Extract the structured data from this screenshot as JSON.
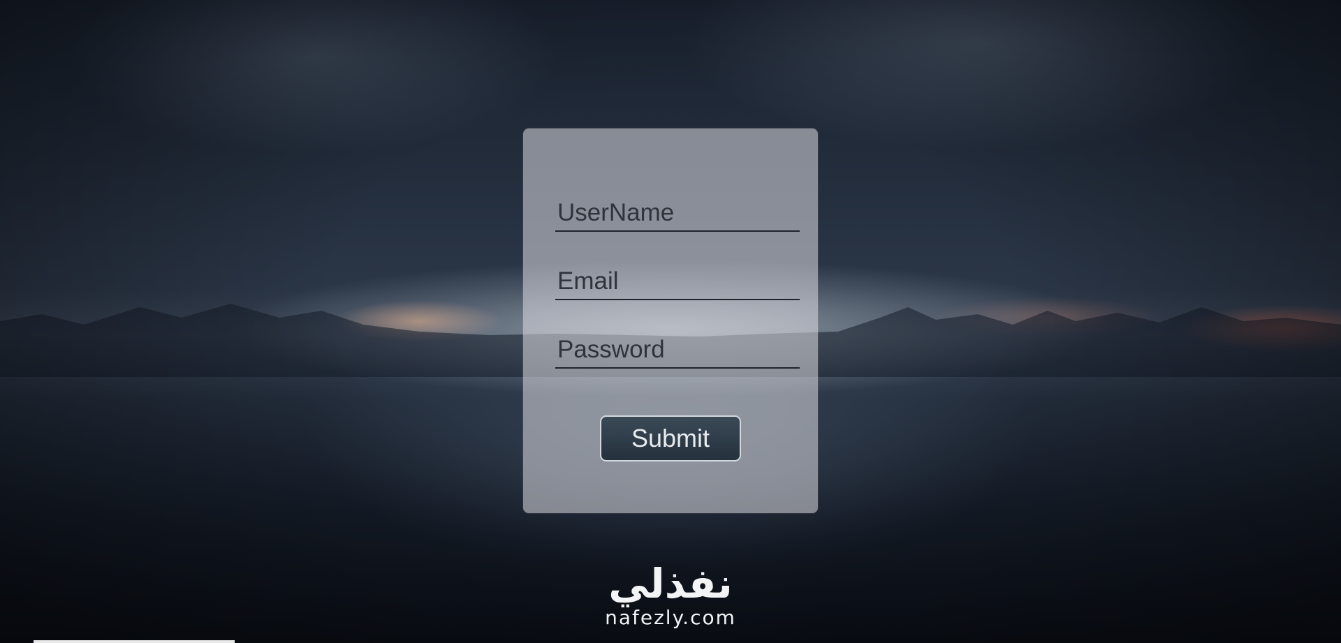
{
  "form": {
    "username_placeholder": "UserName",
    "email_placeholder": "Email",
    "password_placeholder": "Password",
    "submit_label": "Submit"
  },
  "watermark": {
    "arabic_text": "نفذلي",
    "domain_text": "nafezly.com"
  },
  "colors": {
    "card_background": "#dcdce2",
    "field_underline": "#1f232b",
    "button_background": "#2f3c48",
    "button_border": "#d5d9de",
    "button_text": "#e8ebee"
  }
}
